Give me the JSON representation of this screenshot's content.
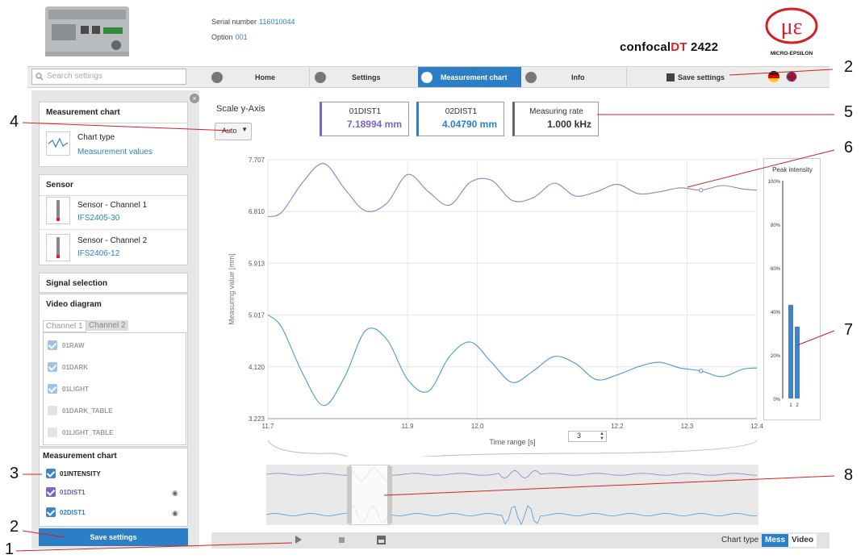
{
  "header": {
    "serial_label": "Serial number",
    "serial_value": "116010044",
    "option_label": "Option",
    "option_value": "001",
    "brand_main": "confocal",
    "brand_dt": "DT",
    "brand_model": " 2422",
    "logo_text": "MICRO-EPSILON"
  },
  "nav": {
    "search_placeholder": "Search settings",
    "home": "Home",
    "settings": "Settings",
    "measurement_chart": "Measurement chart",
    "info": "Info",
    "save_settings": "Save settings"
  },
  "left": {
    "measurement_chart_title": "Measurement chart",
    "chart_type_label": "Chart type",
    "chart_type_value": "Measurement values",
    "sensor_title": "Sensor",
    "sensor1_label": "Sensor - Channel 1",
    "sensor1_value": "IFS2405-30",
    "sensor2_label": "Sensor - Channel 2",
    "sensor2_value": "IFS2406-12",
    "signal_selection": "Signal selection",
    "video_diagram": "Video diagram",
    "tab_ch1": "Channel 1",
    "tab_ch2": "Channel 2",
    "video_items": [
      "01RAW",
      "01DARK",
      "01LIGHT",
      "01DARK_TABLE",
      "01LIGHT_TABLE"
    ],
    "meas_chart_title": "Measurement chart",
    "meas_items": [
      "01INTENSITY",
      "01DIST1",
      "02DIST1"
    ],
    "save_button": "Save settings"
  },
  "main": {
    "scale_label": "Scale y-Axis",
    "scale_value": "Auto",
    "box1_title": "01DIST1",
    "box1_value": "7.18994 mm",
    "box2_title": "02DIST1",
    "box2_value": "4.04790 mm",
    "box3_title": "Measuring rate",
    "box3_value": "1.000 kHz",
    "time_range_value": "3",
    "chart_type_label": "Chart type",
    "chart_type_mess": "Mess",
    "chart_type_video": "Video"
  },
  "callouts": [
    "1",
    "2",
    "2",
    "3",
    "4",
    "5",
    "6",
    "7",
    "8"
  ],
  "colors": {
    "accent": "#2c7fc7",
    "series1": "#8e80c8",
    "series2": "#4a9ad5",
    "brand_red": "#d41f26"
  },
  "chart_data": [
    {
      "type": "line",
      "ylabel": "Measuring value [mm]",
      "xlabel": "Time range [s]",
      "xlim": [
        11.7,
        12.4
      ],
      "ylim": [
        3.223,
        7.707
      ],
      "x_ticks": [
        "11.7",
        "11.9",
        "12.0",
        "12.2",
        "12.3",
        "12.4"
      ],
      "y_ticks": [
        "7.707",
        "6.810",
        "5.913",
        "5.017",
        "4.120",
        "3.223"
      ],
      "grid": true,
      "x": [
        11.7,
        11.72,
        11.75,
        11.78,
        11.81,
        11.84,
        11.87,
        11.9,
        11.93,
        11.96,
        11.99,
        12.02,
        12.05,
        12.08,
        12.11,
        12.14,
        12.17,
        12.2,
        12.23,
        12.26,
        12.29,
        12.32,
        12.35,
        12.38,
        12.4
      ],
      "series": [
        {
          "values": [
            6.72,
            6.8,
            7.32,
            7.64,
            7.2,
            6.82,
            6.95,
            7.45,
            7.15,
            6.92,
            7.32,
            7.35,
            7.0,
            7.05,
            7.3,
            7.08,
            7.15,
            7.28,
            7.12,
            7.15,
            7.22,
            7.18,
            7.26,
            7.2,
            7.18
          ],
          "color": "#8e80c8"
        },
        {
          "values": [
            5.02,
            4.8,
            4.0,
            3.45,
            3.95,
            4.75,
            4.6,
            3.9,
            3.7,
            4.3,
            4.55,
            4.2,
            3.85,
            4.05,
            4.3,
            4.18,
            3.9,
            3.98,
            4.12,
            4.2,
            4.1,
            4.05,
            3.95,
            4.08,
            4.1
          ],
          "color": "#4a9ad5"
        }
      ]
    },
    {
      "type": "bar",
      "title": "Peak intensity",
      "categories": [
        "1",
        "2"
      ],
      "values": [
        43,
        33
      ],
      "ylim": [
        0,
        100
      ],
      "y_ticks": [
        "100%",
        "80%",
        "60%",
        "40%",
        "20%",
        "0%"
      ]
    }
  ]
}
